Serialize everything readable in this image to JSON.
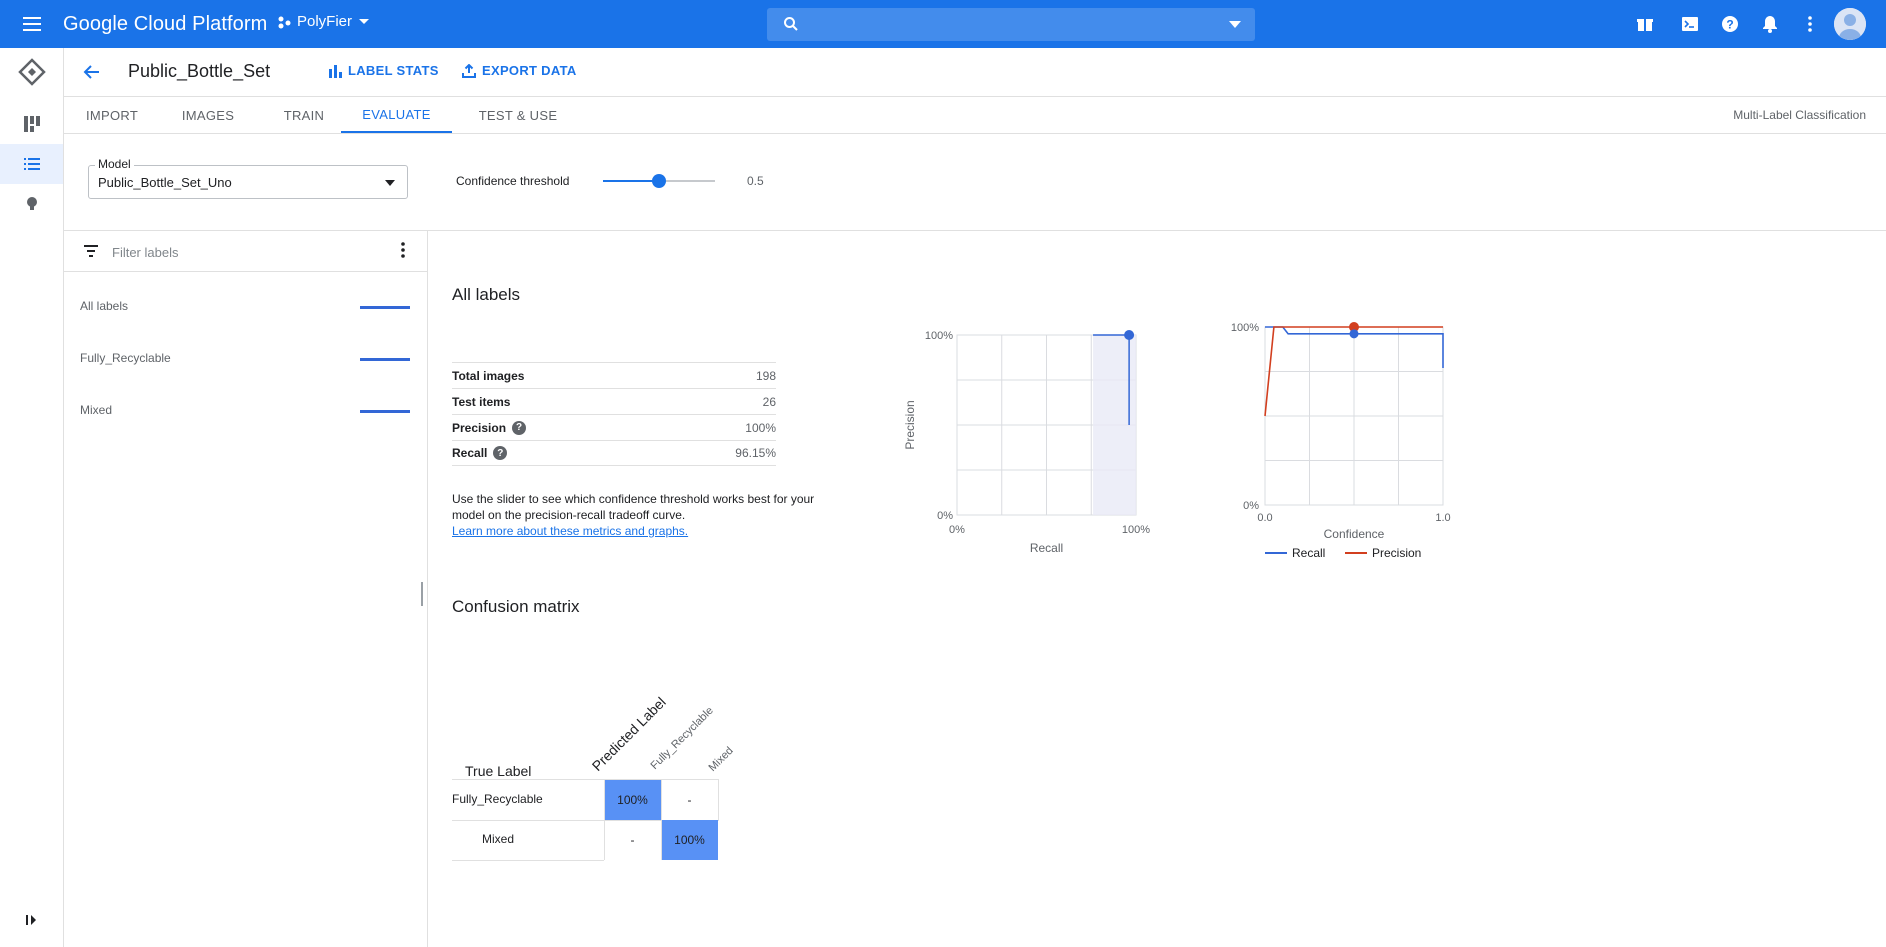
{
  "topbar": {
    "brand": "Google Cloud Platform",
    "project": "PolyFier",
    "search_placeholder": ""
  },
  "header": {
    "dataset_title": "Public_Bottle_Set",
    "label_stats": "LABEL STATS",
    "export_data": "EXPORT DATA"
  },
  "tabs": [
    {
      "label": "IMPORT"
    },
    {
      "label": "IMAGES"
    },
    {
      "label": "TRAIN"
    },
    {
      "label": "EVALUATE",
      "active": true
    },
    {
      "label": "TEST & USE"
    }
  ],
  "mode": "Multi-Label Classification",
  "controls": {
    "model_label": "Model",
    "model_value": "Public_Bottle_Set_Uno",
    "confidence_label": "Confidence threshold",
    "confidence_value": "0.5",
    "confidence_fraction": 0.5
  },
  "labels_panel": {
    "filter_placeholder": "Filter labels",
    "items": [
      {
        "name": "All labels"
      },
      {
        "name": "Fully_Recyclable"
      },
      {
        "name": "Mixed"
      }
    ]
  },
  "main": {
    "section_title": "All labels",
    "stats": [
      {
        "key": "Total images",
        "value": "198"
      },
      {
        "key": "Test items",
        "value": "26"
      },
      {
        "key": "Precision",
        "value": "100%",
        "help": true
      },
      {
        "key": "Recall",
        "value": "96.15%",
        "help": true
      }
    ],
    "help_text": "Use the slider to see which confidence threshold works best for your model on the precision-recall tradeoff curve.",
    "help_link": "Learn more about these metrics and graphs."
  },
  "colors": {
    "accent": "#1a73e8",
    "recall_line": "#3367d6",
    "precision_line": "#d23f1f",
    "matrix_highlight": "#5891f5"
  },
  "chart_data": [
    {
      "type": "line",
      "ylabel": "Precision",
      "xlabel": "Recall",
      "xticks": [
        "0%",
        "100%"
      ],
      "yticks": [
        "0%",
        "100%"
      ],
      "xlim": [
        0,
        1
      ],
      "ylim": [
        0,
        1
      ],
      "grid": true,
      "series": [
        {
          "x": [
            0.9615,
            0.9615,
            0.9615
          ],
          "y": [
            0.5,
            1.0,
            1.0
          ]
        },
        {
          "x": [
            0.76,
            0.9615
          ],
          "y": [
            1.0,
            1.0
          ]
        }
      ],
      "marker": {
        "x": 0.9615,
        "y": 1.0
      }
    },
    {
      "type": "line",
      "xlabel": "Confidence",
      "xticks": [
        "0.0",
        "1.0"
      ],
      "yticks": [
        "0%",
        "100%"
      ],
      "xlim": [
        0,
        1
      ],
      "ylim": [
        0,
        1
      ],
      "grid": true,
      "legend": "bottom",
      "series": [
        {
          "name": "Recall",
          "x": [
            0.0,
            0.05,
            0.1,
            0.13,
            0.5,
            0.99,
            1.0,
            1.0
          ],
          "y": [
            1.0,
            1.0,
            1.0,
            0.9615,
            0.9615,
            0.9615,
            0.9615,
            0.77
          ]
        },
        {
          "name": "Precision",
          "x": [
            0.0,
            0.05,
            0.1,
            0.5,
            1.0
          ],
          "y": [
            0.5,
            1.0,
            1.0,
            1.0,
            1.0
          ]
        }
      ],
      "markers": [
        {
          "series": "Precision",
          "x": 0.5,
          "y": 1.0
        },
        {
          "series": "Recall",
          "x": 0.5,
          "y": 0.9615
        }
      ]
    }
  ],
  "confusion_matrix": {
    "title": "Confusion matrix",
    "true_label": "True Label",
    "predicted_label": "Predicted Label",
    "columns": [
      "Fully_Recyclable",
      "Mixed"
    ],
    "rows": [
      {
        "label": "Fully_Recyclable",
        "cells": [
          "100%",
          "-"
        ]
      },
      {
        "label": "Mixed",
        "cells": [
          "-",
          "100%"
        ]
      }
    ]
  }
}
